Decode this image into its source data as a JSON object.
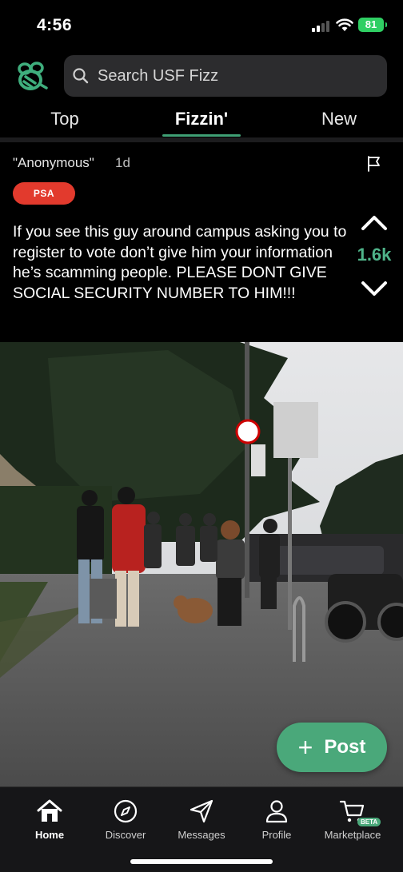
{
  "status": {
    "time": "4:56",
    "battery": "81"
  },
  "search": {
    "placeholder": "Search USF Fizz"
  },
  "tabs": [
    {
      "label": "Top"
    },
    {
      "label": "Fizzin'"
    },
    {
      "label": "New"
    }
  ],
  "active_tab": "Fizzin'",
  "post": {
    "author": "\"Anonymous\"",
    "time": "1d",
    "badge": "PSA",
    "body": "If you see this guy around campus asking you to register to vote don’t give him your information he’s scamming people. PLEASE DONT GIVE SOCIAL SECURITY NUMBER TO HIM!!!",
    "votes": "1.6k"
  },
  "post_button": {
    "label": "Post"
  },
  "bottom_nav": [
    {
      "label": "Home",
      "icon": "home-icon"
    },
    {
      "label": "Discover",
      "icon": "compass-icon"
    },
    {
      "label": "Messages",
      "icon": "send-icon"
    },
    {
      "label": "Profile",
      "icon": "person-icon"
    },
    {
      "label": "Marketplace",
      "icon": "cart-icon",
      "badge": "BETA"
    }
  ],
  "colors": {
    "accent": "#4aa87a",
    "badge_red": "#e23a2d",
    "vote_green": "#4fb389"
  }
}
